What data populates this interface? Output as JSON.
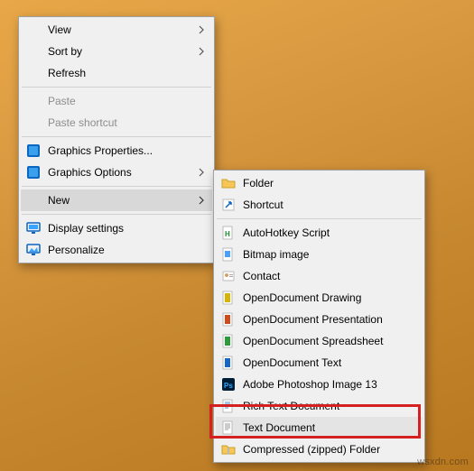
{
  "watermark": "wsxdn.com",
  "primary": {
    "view": "View",
    "sort": "Sort by",
    "refresh": "Refresh",
    "paste": "Paste",
    "paste_shortcut": "Paste shortcut",
    "graphics_props": "Graphics Properties...",
    "graphics_opts": "Graphics Options",
    "new": "New",
    "display": "Display settings",
    "personalize": "Personalize"
  },
  "submenu": {
    "folder": "Folder",
    "shortcut": "Shortcut",
    "ahk": "AutoHotkey Script",
    "bitmap": "Bitmap image",
    "contact": "Contact",
    "od_draw": "OpenDocument Drawing",
    "od_pres": "OpenDocument Presentation",
    "od_sheet": "OpenDocument Spreadsheet",
    "od_text": "OpenDocument Text",
    "psd": "Adobe Photoshop Image 13",
    "rtf": "Rich Text Document",
    "txt": "Text Document",
    "zip": "Compressed (zipped) Folder"
  }
}
